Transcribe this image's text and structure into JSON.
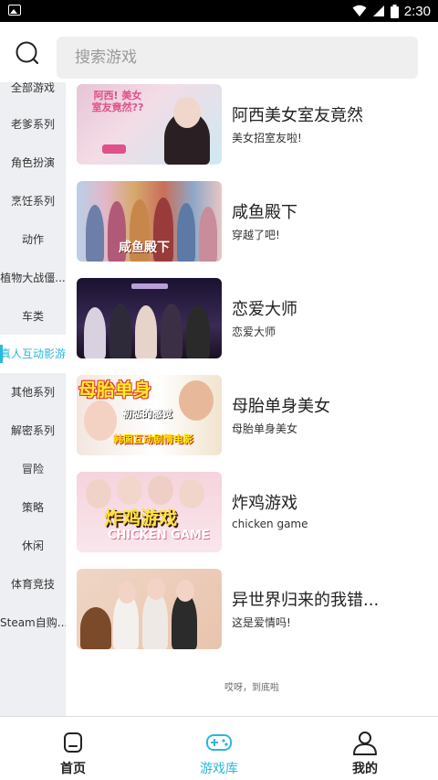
{
  "status_bar": {
    "time": "2:30"
  },
  "header": {
    "search_placeholder": "搜索游戏"
  },
  "sidebar": {
    "items": [
      {
        "label": "全部游戏"
      },
      {
        "label": "老爹系列"
      },
      {
        "label": "角色扮演"
      },
      {
        "label": "烹饪系列"
      },
      {
        "label": "动作"
      },
      {
        "label": "植物大战僵..."
      },
      {
        "label": "车类"
      },
      {
        "label": "真人互动影游"
      },
      {
        "label": "其他系列"
      },
      {
        "label": "解密系列"
      },
      {
        "label": "冒险"
      },
      {
        "label": "策略"
      },
      {
        "label": "休闲"
      },
      {
        "label": "体育竞技"
      },
      {
        "label": "Steam自购..."
      }
    ],
    "active": "真人互动影游"
  },
  "games": [
    {
      "title": "阿西美女室友竟然",
      "subtitle": "美女招室友啦!",
      "thumb_text": "阿西! 美女 室友竟然??"
    },
    {
      "title": "咸鱼殿下",
      "subtitle": "穿越了吧!",
      "thumb_text": "咸鱼殿下"
    },
    {
      "title": "恋爱大师",
      "subtitle": "恋爱大师",
      "thumb_text": ""
    },
    {
      "title": "母胎单身美女",
      "subtitle": "母胎单身美女",
      "thumb_text": "母胎单身",
      "thumb_text2": "初恋的感觉",
      "thumb_text3": "韩国互动剧情电影"
    },
    {
      "title": "炸鸡游戏",
      "subtitle": "chicken game",
      "thumb_text": "炸鸡游戏",
      "thumb_text2": "CHICKEN GAME"
    },
    {
      "title": "异世界归来的我错...",
      "subtitle": "这是爱情吗!",
      "thumb_text": ""
    }
  ],
  "list_end_text": "哎呀，到底啦",
  "bottom_nav": {
    "items": [
      {
        "label": "首页",
        "icon": "home-icon"
      },
      {
        "label": "游戏库",
        "icon": "gamepad-icon"
      },
      {
        "label": "我的",
        "icon": "user-icon"
      }
    ],
    "active": "游戏库"
  },
  "colors": {
    "accent": "#2bb8dc",
    "sidebar_bg": "#eeeff2",
    "search_bg": "#efefef"
  }
}
